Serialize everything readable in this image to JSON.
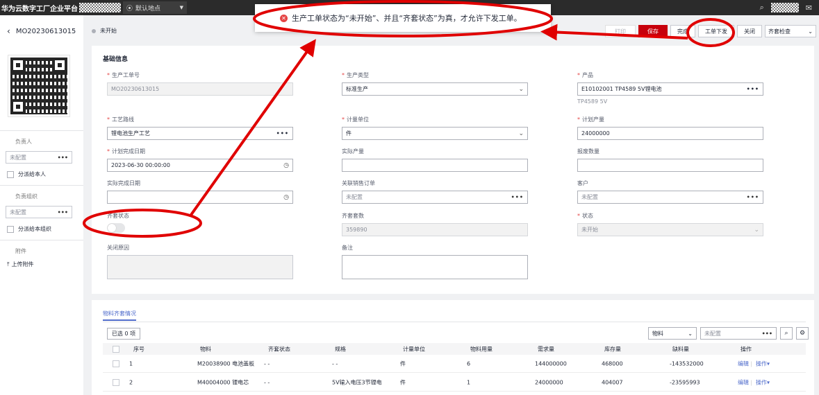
{
  "header": {
    "brand": "华为云数字工厂企业平台",
    "location": "默认地点",
    "mail_icon": "mail-icon",
    "search_icon": "search-icon"
  },
  "left_panel": {
    "order_code": "MO20230613015",
    "owner_label": "负责人",
    "owner_value": "未配置",
    "assign_self": "分派给本人",
    "org_label": "负责组织",
    "org_value": "未配置",
    "assign_org": "分派给本组织",
    "attachment_label": "附件",
    "upload_label": "上传附件"
  },
  "status": {
    "text": "未开始"
  },
  "toolbar": {
    "print": "打印",
    "save": "保存",
    "complete": "完成",
    "issue": "工单下发",
    "close": "关闭",
    "kit_check": "齐套检查"
  },
  "toast": {
    "message": "生产工单状态为“未开始”、并且“齐套状态”为真，才允许下发工单。"
  },
  "form": {
    "section_title": "基础信息",
    "order_no_label": "生产工单号",
    "order_no_value": "MO20230613015",
    "prod_type_label": "生产类型",
    "prod_type_value": "标准生产",
    "product_label": "产品",
    "product_value": "E10102001 TP4589 5V锂电池",
    "product_sub": "TP4589 5V",
    "route_label": "工艺路线",
    "route_value": "锂电池生产工艺",
    "unit_label": "计量单位",
    "unit_value": "件",
    "plan_qty_label": "计划产量",
    "plan_qty_value": "24000000",
    "plan_date_label": "计划完成日期",
    "plan_date_value": "2023-06-30 00:00:00",
    "actual_qty_label": "实际产量",
    "scrap_label": "报废数量",
    "actual_date_label": "实际完成日期",
    "sales_order_label": "关联销售订单",
    "sales_order_placeholder": "未配置",
    "customer_label": "客户",
    "customer_placeholder": "未配置",
    "kit_status_label": "齐套状态",
    "kit_count_label": "齐套套数",
    "kit_count_value": "359890",
    "state_label": "状态",
    "state_value": "未开始",
    "close_reason_label": "关闭原因",
    "remark_label": "备注"
  },
  "materials": {
    "tab": "物料齐套情况",
    "selected": "已选 0 项",
    "filter": "物料",
    "filter_input": "未配置",
    "columns": [
      "序号",
      "物料",
      "齐套状态",
      "规格",
      "计量单位",
      "物料用量",
      "需求量",
      "库存量",
      "缺料量",
      "操作"
    ],
    "rows": [
      {
        "no": "1",
        "material": "M20038900 电池盖板",
        "kit": "- -",
        "spec": "- -",
        "unit": "件",
        "usage": "6",
        "demand": "144000000",
        "stock": "468000",
        "short": "-143532000",
        "edit": "编辑",
        "more": "操作▾"
      },
      {
        "no": "2",
        "material": "M40004000 锂电芯",
        "kit": "- -",
        "spec": "5V输入电压3节锂电",
        "unit": "件",
        "usage": "1",
        "demand": "24000000",
        "stock": "404007",
        "short": "-23595993",
        "edit": "编辑",
        "more": "操作▾"
      }
    ]
  }
}
